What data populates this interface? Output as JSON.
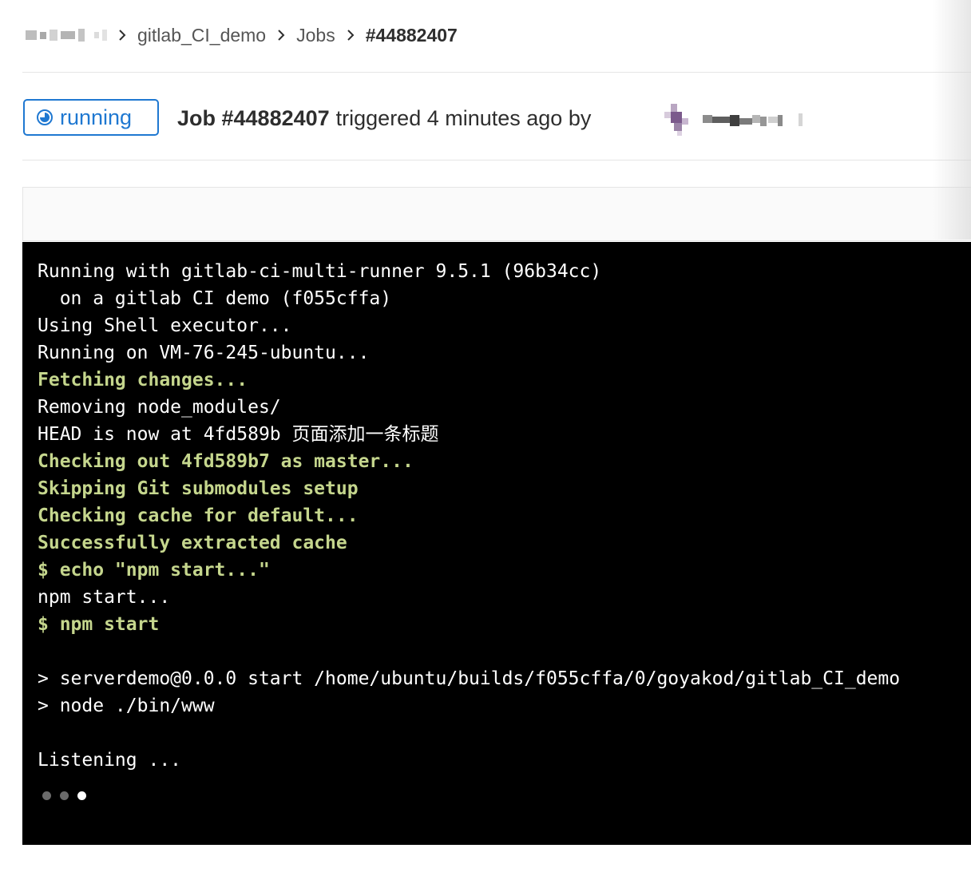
{
  "breadcrumb": {
    "namespace_obscured": true,
    "project": "gitlab_CI_demo",
    "section": "Jobs",
    "current": "#44882407"
  },
  "job": {
    "status": "running",
    "title_id": "Job #44882407",
    "title_rest": "triggered 4 minutes ago by",
    "status_color": "#1f78d1"
  },
  "log": {
    "lines": [
      {
        "text": "Running with gitlab-ci-multi-runner 9.5.1 (96b34cc)",
        "kind": "normal"
      },
      {
        "text": "  on a gitlab CI demo (f055cffa)",
        "kind": "normal"
      },
      {
        "text": "Using Shell executor...",
        "kind": "normal"
      },
      {
        "text": "Running on VM-76-245-ubuntu...",
        "kind": "normal"
      },
      {
        "text": "Fetching changes...",
        "kind": "section"
      },
      {
        "text": "Removing node_modules/",
        "kind": "normal"
      },
      {
        "text": "HEAD is now at 4fd589b 页面添加一条标题",
        "kind": "normal"
      },
      {
        "text": "Checking out 4fd589b7 as master...",
        "kind": "section"
      },
      {
        "text": "Skipping Git submodules setup",
        "kind": "section"
      },
      {
        "text": "Checking cache for default...",
        "kind": "section"
      },
      {
        "text": "Successfully extracted cache",
        "kind": "section"
      },
      {
        "text": "$ echo \"npm start...\"",
        "kind": "section"
      },
      {
        "text": "npm start...",
        "kind": "normal"
      },
      {
        "text": "$ npm start",
        "kind": "section"
      },
      {
        "text": "",
        "kind": "normal"
      },
      {
        "text": "> serverdemo@0.0.0 start /home/ubuntu/builds/f055cffa/0/goyakod/gitlab_CI_demo",
        "kind": "normal"
      },
      {
        "text": "> node ./bin/www",
        "kind": "normal"
      },
      {
        "text": "",
        "kind": "normal"
      },
      {
        "text": "Listening ...",
        "kind": "normal"
      }
    ],
    "section_color": "#c5d68d",
    "background": "#000000"
  }
}
